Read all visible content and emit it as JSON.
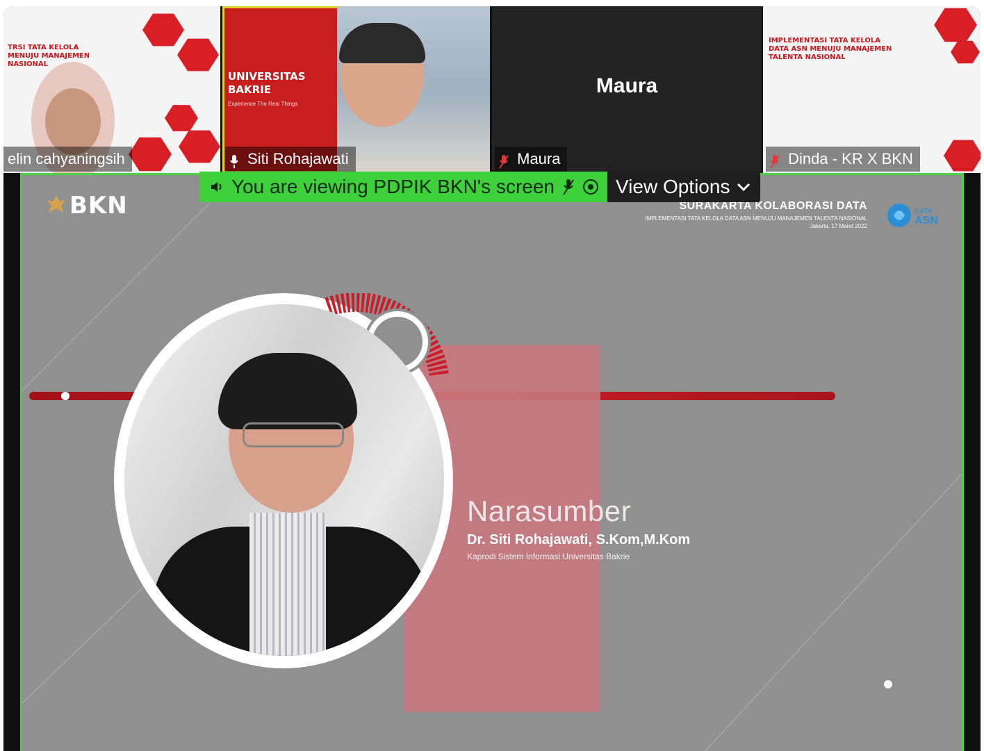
{
  "participants": [
    {
      "name": "elin cahyaningsih"
    },
    {
      "name": "Siti Rohajawati",
      "slide_title": "UNIVERSITAS BAKRIE",
      "slide_subtitle": "Experience The Real Things"
    },
    {
      "name": "Maura",
      "center_name": "Maura"
    },
    {
      "name": "Dinda - KR X BKN"
    }
  ],
  "share_banner": {
    "text": "You are viewing PDPIK BKN's screen",
    "view_options": "View Options"
  },
  "slide": {
    "logo": "BKN",
    "header_title": "SURAKARTA KOLABORASI DATA",
    "header_subtitle": "IMPLEMENTASI TATA KELOLA DATA ASN MENUJU MANAJEMEN TALENTA NASIONAL",
    "header_date": "Jakarta, 17 Maret 2022",
    "section": "Narasumber",
    "speaker_name": "Dr. Siti Rohajawati, S.Kom,M.Kom",
    "speaker_role": "Kaprodi Sistem Informasi Universitas Bakrie"
  },
  "colors": {
    "accent_green": "#3fd13c",
    "brand_red": "#c81d1d",
    "slide_gray": "#909090"
  }
}
